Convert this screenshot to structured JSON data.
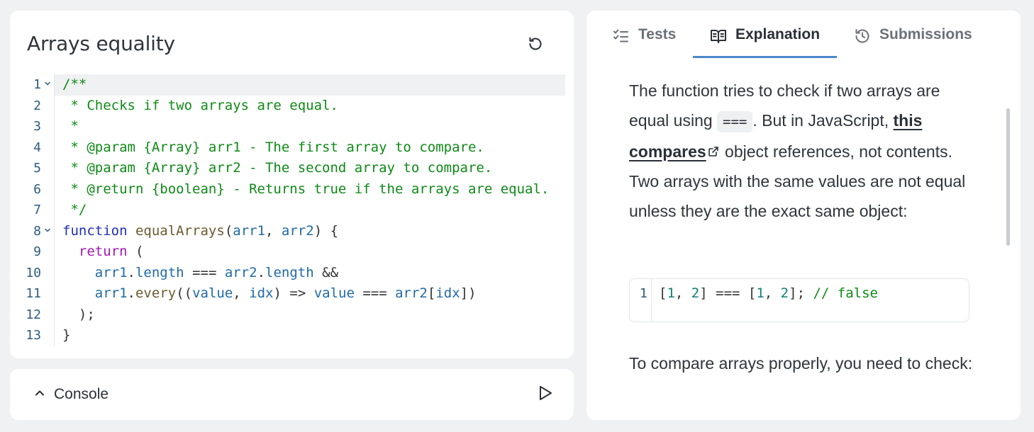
{
  "editor": {
    "title": "Arrays equality",
    "reset_icon": "reset-icon",
    "lines": [
      {
        "n": "1",
        "fold": true,
        "tokens": [
          {
            "t": "/**",
            "c": "com"
          }
        ]
      },
      {
        "n": "2",
        "fold": false,
        "tokens": [
          {
            "t": " * Checks if two arrays are equal.",
            "c": "com"
          }
        ]
      },
      {
        "n": "3",
        "fold": false,
        "tokens": [
          {
            "t": " *",
            "c": "com"
          }
        ]
      },
      {
        "n": "4",
        "fold": false,
        "tokens": [
          {
            "t": " * @param {Array} arr1 - The first array to compare.",
            "c": "com"
          }
        ]
      },
      {
        "n": "5",
        "fold": false,
        "tokens": [
          {
            "t": " * @param {Array} arr2 - The second array to compare.",
            "c": "com"
          }
        ]
      },
      {
        "n": "6",
        "fold": false,
        "tokens": [
          {
            "t": " * @return {boolean} - Returns true if the arrays are equal.",
            "c": "com"
          }
        ]
      },
      {
        "n": "7",
        "fold": false,
        "tokens": [
          {
            "t": " */",
            "c": "com"
          }
        ]
      },
      {
        "n": "8",
        "fold": true,
        "tokens": [
          {
            "t": "function",
            "c": "kw"
          },
          {
            "t": " ",
            "c": "p"
          },
          {
            "t": "equalArrays",
            "c": "fn"
          },
          {
            "t": "(",
            "c": "p"
          },
          {
            "t": "arr1",
            "c": "var"
          },
          {
            "t": ", ",
            "c": "p"
          },
          {
            "t": "arr2",
            "c": "var"
          },
          {
            "t": ") {",
            "c": "p"
          }
        ]
      },
      {
        "n": "9",
        "fold": false,
        "tokens": [
          {
            "t": "  ",
            "c": "p"
          },
          {
            "t": "return",
            "c": "ret"
          },
          {
            "t": " (",
            "c": "p"
          }
        ]
      },
      {
        "n": "10",
        "fold": false,
        "tokens": [
          {
            "t": "    ",
            "c": "p"
          },
          {
            "t": "arr1",
            "c": "var"
          },
          {
            "t": ".",
            "c": "p"
          },
          {
            "t": "length",
            "c": "var"
          },
          {
            "t": " === ",
            "c": "p"
          },
          {
            "t": "arr2",
            "c": "var"
          },
          {
            "t": ".",
            "c": "p"
          },
          {
            "t": "length",
            "c": "var"
          },
          {
            "t": " &&",
            "c": "p"
          }
        ]
      },
      {
        "n": "11",
        "fold": false,
        "tokens": [
          {
            "t": "    ",
            "c": "p"
          },
          {
            "t": "arr1",
            "c": "var"
          },
          {
            "t": ".",
            "c": "p"
          },
          {
            "t": "every",
            "c": "fn"
          },
          {
            "t": "((",
            "c": "p"
          },
          {
            "t": "value",
            "c": "var"
          },
          {
            "t": ", ",
            "c": "p"
          },
          {
            "t": "idx",
            "c": "var"
          },
          {
            "t": ") => ",
            "c": "p"
          },
          {
            "t": "value",
            "c": "var"
          },
          {
            "t": " === ",
            "c": "p"
          },
          {
            "t": "arr2",
            "c": "var"
          },
          {
            "t": "[",
            "c": "p"
          },
          {
            "t": "idx",
            "c": "var"
          },
          {
            "t": "])",
            "c": "p"
          }
        ]
      },
      {
        "n": "12",
        "fold": false,
        "tokens": [
          {
            "t": "  );",
            "c": "p"
          }
        ]
      },
      {
        "n": "13",
        "fold": false,
        "tokens": [
          {
            "t": "}",
            "c": "p"
          }
        ]
      }
    ],
    "active_line": 1
  },
  "console": {
    "label": "Console",
    "toggle_icon": "chevron-up-icon",
    "run_icon": "play-icon"
  },
  "tabs": [
    {
      "label": "Tests",
      "icon": "checklist-icon",
      "active": false
    },
    {
      "label": "Explanation",
      "icon": "book-icon",
      "active": true
    },
    {
      "label": "Submissions",
      "icon": "history-icon",
      "active": false
    }
  ],
  "explanation": {
    "p1_a": "The function tries to check if two arrays are equal using ",
    "p1_code": "===",
    "p1_b": ". But in JavaScript, ",
    "p1_link": "this compares",
    "p1_c": " object references, not contents. Two arrays with the same values are not equal unless they are the exact same object:",
    "snippet_line": "1",
    "snippet_tokens": [
      {
        "t": "[",
        "c": "p"
      },
      {
        "t": "1",
        "c": "num"
      },
      {
        "t": ", ",
        "c": "p"
      },
      {
        "t": "2",
        "c": "num"
      },
      {
        "t": "] === [",
        "c": "p"
      },
      {
        "t": "1",
        "c": "num"
      },
      {
        "t": ", ",
        "c": "p"
      },
      {
        "t": "2",
        "c": "num"
      },
      {
        "t": "]; ",
        "c": "p"
      },
      {
        "t": "// false",
        "c": "com"
      }
    ],
    "p2": "To compare arrays properly, you need to check:"
  },
  "colors": {
    "accent": "#4a88c9",
    "comment": "#0e8a16",
    "keyword": "#1f2fb8"
  }
}
